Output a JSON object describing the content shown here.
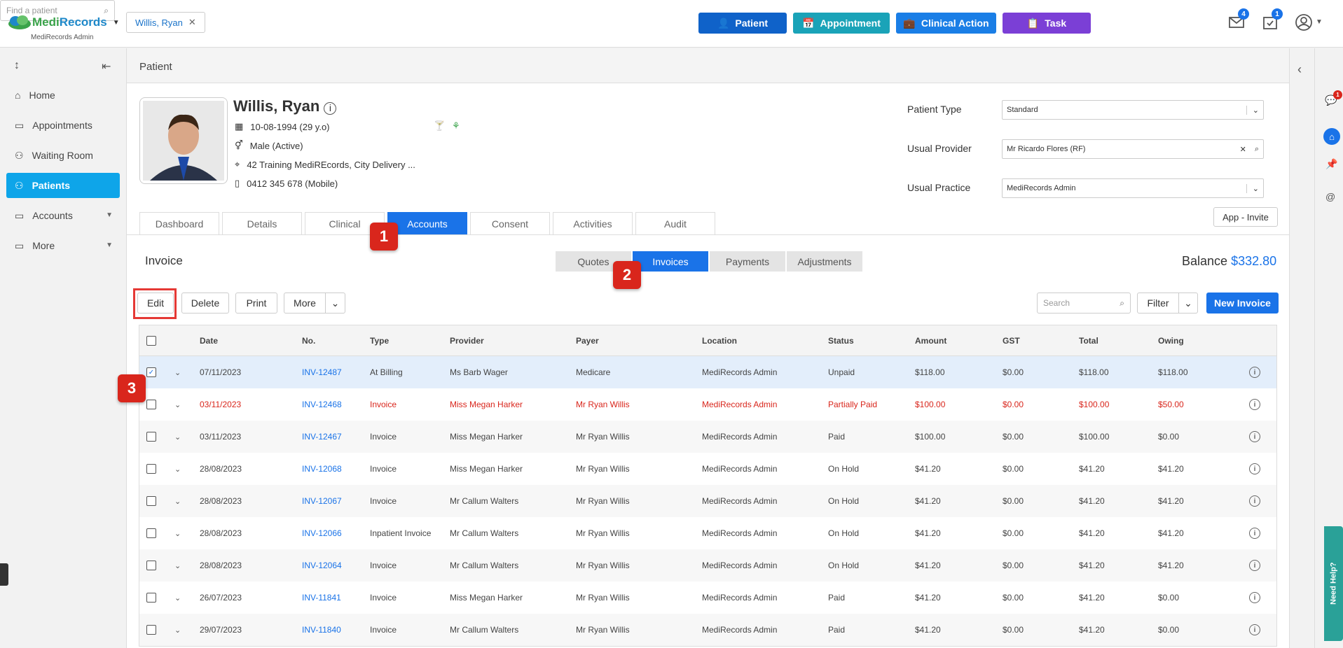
{
  "app": {
    "logo_main": "Medi",
    "logo_accent": "Records",
    "logo_sub": "MediRecords Admin"
  },
  "header": {
    "patient_chip": "Willis, Ryan",
    "buttons": [
      {
        "label": "Patient",
        "color": "#0f62c9"
      },
      {
        "label": "Appointment",
        "color": "#1aa3b8"
      },
      {
        "label": "Clinical Action",
        "color": "#1a7ee6"
      },
      {
        "label": "Task",
        "color": "#7b3fd6"
      }
    ],
    "find_placeholder": "Find a patient",
    "mail_count": "4",
    "task_count": "1"
  },
  "sidebar": {
    "items": [
      {
        "label": "Home"
      },
      {
        "label": "Appointments"
      },
      {
        "label": "Waiting Room"
      },
      {
        "label": "Patients"
      },
      {
        "label": "Accounts"
      },
      {
        "label": "More"
      }
    ]
  },
  "page": {
    "title": "Patient"
  },
  "patient": {
    "name": "Willis, Ryan",
    "dob": "10-08-1994 (29 y.o)",
    "gender": "Male (Active)",
    "address": "42 Training MediREcords, City Delivery ...",
    "phone": "0412 345 678 (Mobile)",
    "fields": [
      {
        "label": "Patient Type",
        "value": "Standard"
      },
      {
        "label": "Usual Provider",
        "value": "Mr Ricardo Flores (RF)"
      },
      {
        "label": "Usual Practice",
        "value": "MediRecords Admin"
      }
    ],
    "app_invite": "App - Invite"
  },
  "tabs": [
    "Dashboard",
    "Details",
    "Clinical",
    "Accounts",
    "Consent",
    "Activities",
    "Audit"
  ],
  "section": {
    "title": "Invoice",
    "segments": [
      "Quotes",
      "Invoices",
      "Payments",
      "Adjustments"
    ],
    "balance_label": "Balance",
    "balance_value": "$332.80"
  },
  "toolbar": {
    "edit": "Edit",
    "delete": "Delete",
    "print": "Print",
    "more": "More",
    "search_placeholder": "Search",
    "filter": "Filter",
    "new_invoice": "New Invoice"
  },
  "markers": [
    "1",
    "2",
    "3"
  ],
  "table": {
    "headers": [
      "Date",
      "No.",
      "Type",
      "Provider",
      "Payer",
      "Location",
      "Status",
      "Amount",
      "GST",
      "Total",
      "Owing"
    ],
    "rows": [
      [
        "07/11/2023",
        "INV-12487",
        "At Billing",
        "Ms Barb Wager",
        "Medicare",
        "MediRecords Admin",
        "Unpaid",
        "$118.00",
        "$0.00",
        "$118.00",
        "$118.00"
      ],
      [
        "03/11/2023",
        "INV-12468",
        "Invoice",
        "Miss Megan Harker",
        "Mr Ryan Willis",
        "MediRecords Admin",
        "Partially Paid",
        "$100.00",
        "$0.00",
        "$100.00",
        "$50.00"
      ],
      [
        "03/11/2023",
        "INV-12467",
        "Invoice",
        "Miss Megan Harker",
        "Mr Ryan Willis",
        "MediRecords Admin",
        "Paid",
        "$100.00",
        "$0.00",
        "$100.00",
        "$0.00"
      ],
      [
        "28/08/2023",
        "INV-12068",
        "Invoice",
        "Miss Megan Harker",
        "Mr Ryan Willis",
        "MediRecords Admin",
        "On Hold",
        "$41.20",
        "$0.00",
        "$41.20",
        "$41.20"
      ],
      [
        "28/08/2023",
        "INV-12067",
        "Invoice",
        "Mr Callum Walters",
        "Mr Ryan Willis",
        "MediRecords Admin",
        "On Hold",
        "$41.20",
        "$0.00",
        "$41.20",
        "$41.20"
      ],
      [
        "28/08/2023",
        "INV-12066",
        "Inpatient Invoice",
        "Mr Callum Walters",
        "Mr Ryan Willis",
        "MediRecords Admin",
        "On Hold",
        "$41.20",
        "$0.00",
        "$41.20",
        "$41.20"
      ],
      [
        "28/08/2023",
        "INV-12064",
        "Invoice",
        "Mr Callum Walters",
        "Mr Ryan Willis",
        "MediRecords Admin",
        "On Hold",
        "$41.20",
        "$0.00",
        "$41.20",
        "$41.20"
      ],
      [
        "26/07/2023",
        "INV-11841",
        "Invoice",
        "Miss Megan Harker",
        "Mr Ryan Willis",
        "MediRecords Admin",
        "Paid",
        "$41.20",
        "$0.00",
        "$41.20",
        "$0.00"
      ],
      [
        "29/07/2023",
        "INV-11840",
        "Invoice",
        "Mr Callum Walters",
        "Mr Ryan Willis",
        "MediRecords Admin",
        "Paid",
        "$41.20",
        "$0.00",
        "$41.20",
        "$0.00"
      ]
    ]
  },
  "help": "Need Help?",
  "notif_count": "1"
}
